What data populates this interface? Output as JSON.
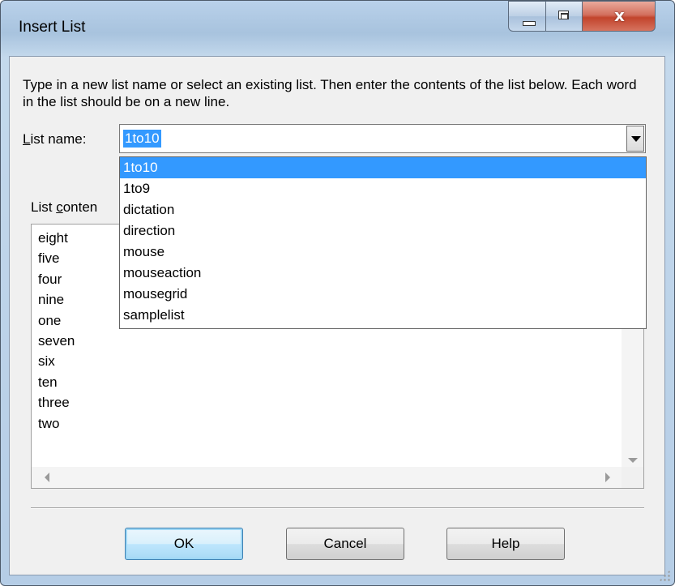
{
  "window": {
    "title": "Insert List",
    "controls": {
      "minimize": "minimize",
      "maximize": "maximize",
      "close": "x"
    }
  },
  "description": "Type in a new list name or select an existing list. Then enter the contents of the list below. Each word in the list should be on a new line.",
  "list_name": {
    "label_prefix": "L",
    "label_rest": "ist name:",
    "value": "1to10",
    "options": [
      "1to10",
      "1to9",
      "dictation",
      "direction",
      "mouse",
      "mouseaction",
      "mousegrid",
      "samplelist"
    ],
    "selected_index": 0
  },
  "list_contents": {
    "label_prefix": "List ",
    "label_accel": "c",
    "label_rest": "onten",
    "lines": [
      "eight",
      "five",
      "four",
      "nine",
      "one",
      "seven",
      "six",
      "ten",
      "three",
      "two"
    ]
  },
  "buttons": {
    "ok": "OK",
    "cancel": "Cancel",
    "help": "Help"
  },
  "colors": {
    "selection": "#3399ff",
    "close_button": "#c2442c",
    "dialog_bg": "#f0f0f0"
  }
}
